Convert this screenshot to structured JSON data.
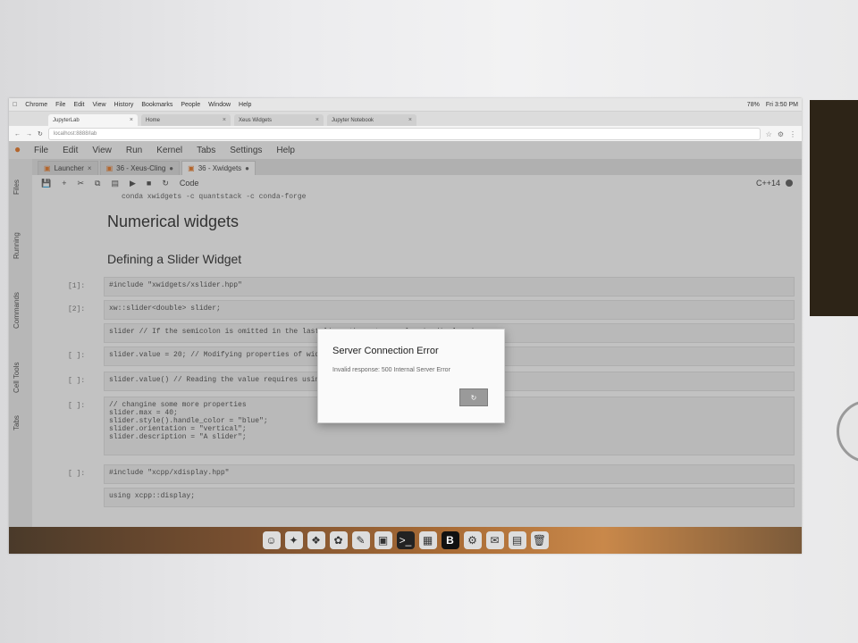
{
  "mac_menubar": {
    "items": [
      "Chrome",
      "File",
      "Edit",
      "View",
      "History",
      "Bookmarks",
      "People",
      "Window",
      "Help"
    ],
    "status": "Fri 3:50 PM",
    "battery": "78%"
  },
  "browser_tabs": [
    {
      "label": "JupyterLab",
      "active": true
    },
    {
      "label": "Home",
      "active": false
    },
    {
      "label": "Xeus Widgets",
      "active": false
    },
    {
      "label": "Jupyter Notebook",
      "active": false
    }
  ],
  "address": "localhost:8888/lab",
  "jl_menu": [
    "File",
    "Edit",
    "View",
    "Run",
    "Kernel",
    "Tabs",
    "Settings",
    "Help"
  ],
  "left_rail": [
    "Files",
    "Running",
    "Commands",
    "Cell Tools",
    "Tabs"
  ],
  "doc_tabs": [
    {
      "label": "Launcher",
      "active": false
    },
    {
      "label": "36 - Xeus-Cling",
      "active": false
    },
    {
      "label": "36 - Xwidgets",
      "active": true
    }
  ],
  "toolbar": {
    "cell_type": "Code",
    "kernel": "C++14"
  },
  "notebook": {
    "install_line": "conda xwidgets -c quantstack -c conda-forge",
    "h1": "Numerical widgets",
    "h2": "Defining a Slider Widget",
    "cells": [
      {
        "prompt": "[1]:",
        "code": "#include \"xwidgets/xslider.hpp\""
      },
      {
        "prompt": "[2]:",
        "code": "xw::slider<double> slider;"
      },
      {
        "prompt": "",
        "code": "slider                // If the semicolon is omitted in the last line, the return value is displayed."
      },
      {
        "prompt": "[ ]:",
        "code": "slider.value = 20;     // Modifying properties of widgets triggers the update of the frontend."
      },
      {
        "prompt": "[ ]:",
        "code": "slider.value()         // Reading the value requires using the call operator"
      },
      {
        "prompt": "[ ]:",
        "code": "// changine some more properties\nslider.max = 40;\nslider.style().handle_color = \"blue\";\nslider.orientation = \"vertical\";\nslider.description = \"A slider\";"
      },
      {
        "prompt": "[ ]:",
        "code": "#include \"xcpp/xdisplay.hpp\""
      },
      {
        "prompt": "",
        "code": "using xcpp::display;"
      }
    ]
  },
  "dialog": {
    "title": "Server Connection Error",
    "message": "Invalid response: 500 Internal Server Error",
    "button_icon": "refresh-icon"
  },
  "dock_apps": [
    "finder-icon",
    "launchpad-icon",
    "safari-icon",
    "photos-icon",
    "notes-icon",
    "preview-icon",
    "terminal-icon",
    "calendar-icon",
    "bbedit-icon",
    "settings-icon",
    "mail-icon",
    "books-icon",
    "trash-icon"
  ]
}
